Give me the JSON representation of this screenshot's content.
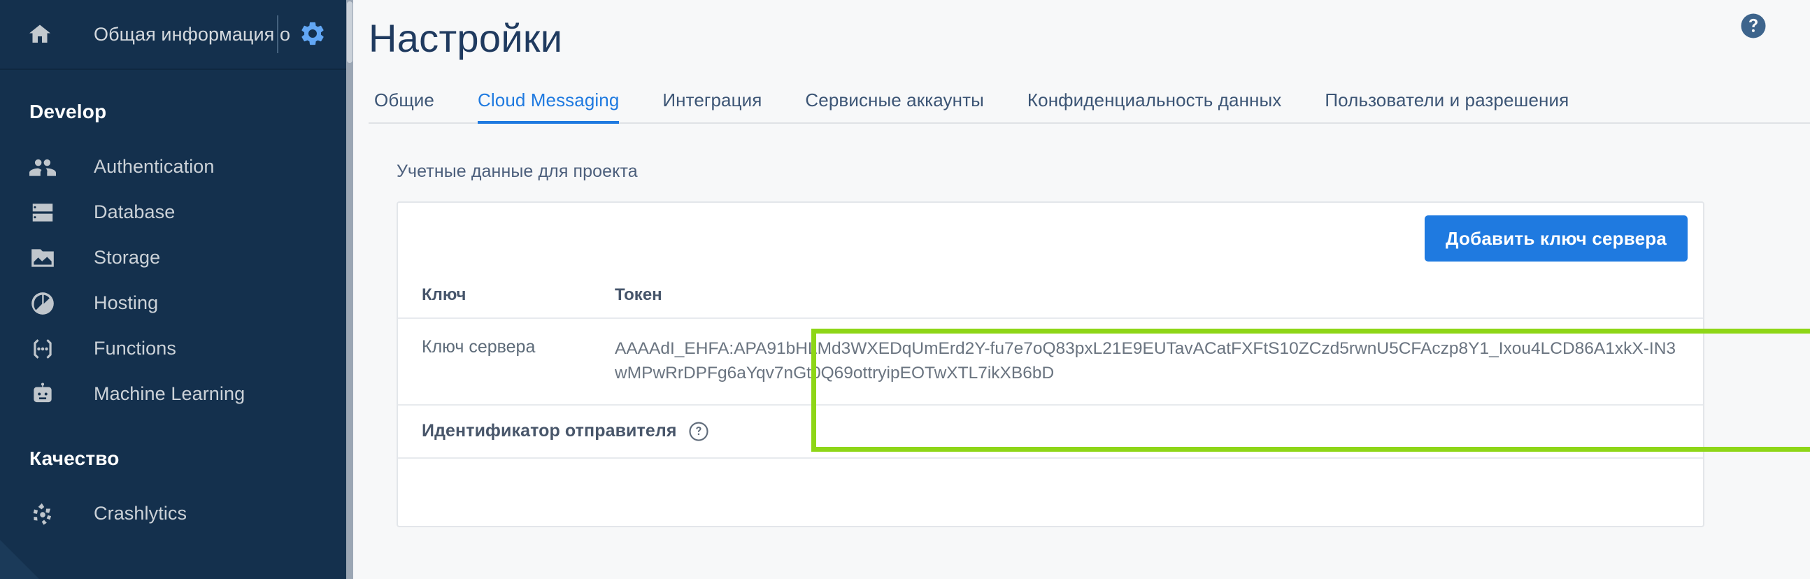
{
  "sidebar": {
    "project_name": "Общая информация о",
    "home_icon": "home-icon",
    "gear_icon": "gear-icon",
    "sections": [
      {
        "title": "Develop",
        "items": [
          {
            "label": "Authentication",
            "icon": "people-icon"
          },
          {
            "label": "Database",
            "icon": "database-icon"
          },
          {
            "label": "Storage",
            "icon": "folder-image-icon"
          },
          {
            "label": "Hosting",
            "icon": "globe-icon"
          },
          {
            "label": "Functions",
            "icon": "functions-icon"
          },
          {
            "label": "Machine Learning",
            "icon": "robot-icon"
          }
        ]
      },
      {
        "title": "Качество",
        "items": [
          {
            "label": "Crashlytics",
            "icon": "crashlytics-icon"
          }
        ]
      }
    ]
  },
  "header": {
    "title": "Настройки",
    "help_icon": "help-circle-icon"
  },
  "tabs": [
    {
      "label": "Общие",
      "active": false
    },
    {
      "label": "Cloud Messaging",
      "active": true
    },
    {
      "label": "Интеграция",
      "active": false
    },
    {
      "label": "Сервисные аккаунты",
      "active": false
    },
    {
      "label": "Конфиденциальность данных",
      "active": false
    },
    {
      "label": "Пользователи и разрешения",
      "active": false
    }
  ],
  "main": {
    "section_label": "Учетные данные для проекта",
    "add_key_button": "Добавить ключ сервера",
    "table": {
      "headers": [
        "Ключ",
        "Токен"
      ],
      "rows": [
        {
          "key": "Ключ сервера",
          "token": "AAAAdI_EHFA:APA91bHLMd3WXEDqUmErd2Y-fu7e7oQ83pxL21E9EUTavACatFXFtS10ZCzd5rwnU5CFAczp8Y1_Ixou4LCD86A1xkX-IN3wMPwRrDPFg6aYqv7nGt0Q69ottryipEOTwXTL7ikXB6bD"
        }
      ]
    },
    "sender_id_label": "Идентификатор отправителя",
    "sender_id_help_icon": "question-circle-icon"
  },
  "colors": {
    "sidebar_bg": "#14304d",
    "accent_blue": "#1f7ae0",
    "highlight_green": "#8ed617",
    "title_navy": "#1f3a5f"
  }
}
